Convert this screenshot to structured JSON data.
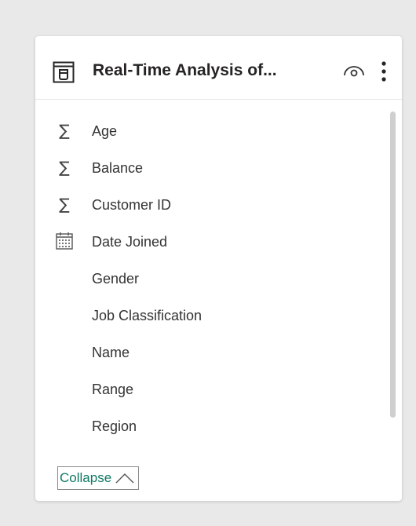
{
  "card": {
    "title": "Real-Time Analysis of...",
    "icons": {
      "table": "table-icon",
      "visibility": "eye-icon",
      "more": "more-options-icon"
    }
  },
  "fields": [
    {
      "label": "Age",
      "icon": "sigma-icon"
    },
    {
      "label": "Balance",
      "icon": "sigma-icon"
    },
    {
      "label": "Customer ID",
      "icon": "sigma-icon"
    },
    {
      "label": "Date Joined",
      "icon": "calendar-icon"
    },
    {
      "label": "Gender",
      "icon": ""
    },
    {
      "label": "Job Classification",
      "icon": ""
    },
    {
      "label": "Name",
      "icon": ""
    },
    {
      "label": "Range",
      "icon": ""
    },
    {
      "label": "Region",
      "icon": ""
    }
  ],
  "collapse": {
    "label": "Collapse",
    "icon": "chevron-up-icon"
  },
  "colors": {
    "background": "#e9e9e9",
    "card": "#ffffff",
    "title_text": "#252423",
    "link_teal": "#117865"
  }
}
